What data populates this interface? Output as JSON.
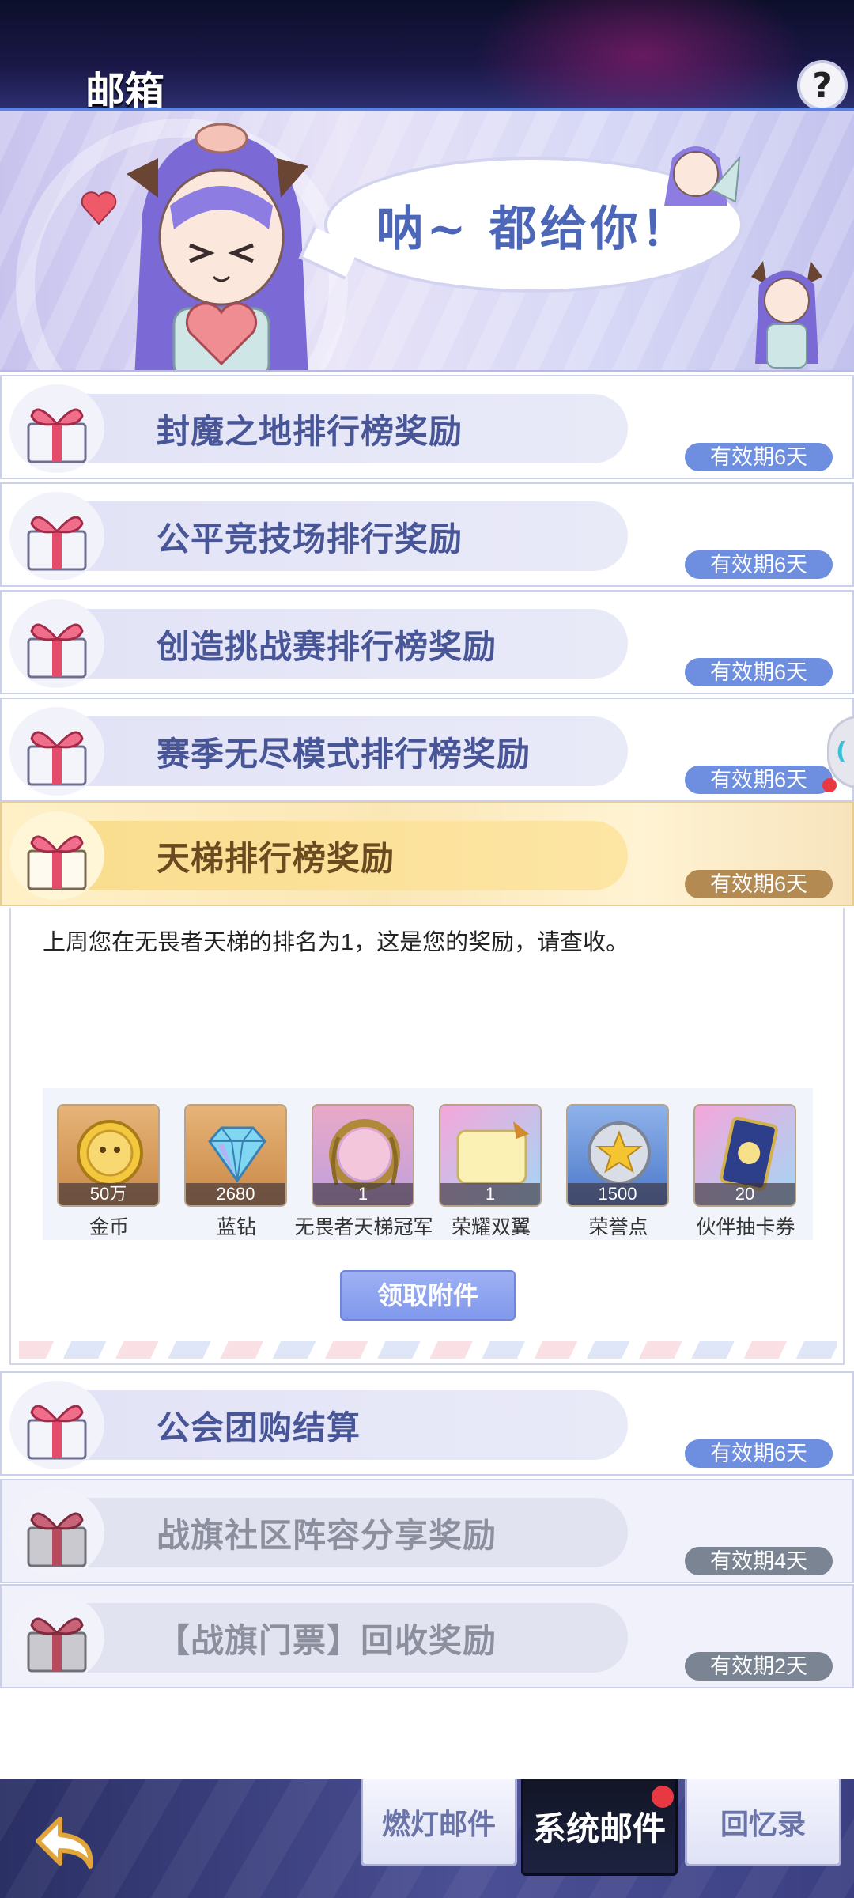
{
  "header": {
    "title": "邮箱",
    "help_glyph": "?"
  },
  "banner": {
    "speech": "呐~ 都给你！"
  },
  "mails": [
    {
      "subject": "封魔之地排行榜奖励",
      "expiry": "有效期6天",
      "state": "unread"
    },
    {
      "subject": "公平竞技场排行奖励",
      "expiry": "有效期6天",
      "state": "unread"
    },
    {
      "subject": "创造挑战赛排行榜奖励",
      "expiry": "有效期6天",
      "state": "unread"
    },
    {
      "subject": "赛季无尽模式排行榜奖励",
      "expiry": "有效期6天",
      "state": "unread",
      "red_dot": true
    },
    {
      "subject": "天梯排行榜奖励",
      "expiry": "有效期6天",
      "state": "selected"
    },
    {
      "subject": "公会团购结算",
      "expiry": "有效期6天",
      "state": "unread"
    },
    {
      "subject": "战旗社区阵容分享奖励",
      "expiry": "有效期4天",
      "state": "read"
    },
    {
      "subject": "【战旗门票】回收奖励",
      "expiry": "有效期2天",
      "state": "read"
    }
  ],
  "detail": {
    "body": "上周您在无畏者天梯的排名为1，这是您的奖励，请查收。",
    "attachments": [
      {
        "name": "金币",
        "qty": "50万",
        "icon": "gold-coin-icon"
      },
      {
        "name": "蓝钻",
        "qty": "2680",
        "icon": "blue-diamond-icon"
      },
      {
        "name": "无畏者天梯冠军",
        "qty": "1",
        "icon": "laurel-frame-icon"
      },
      {
        "name": "荣耀双翼",
        "qty": "1",
        "icon": "wings-card-icon"
      },
      {
        "name": "荣誉点",
        "qty": "1500",
        "icon": "honor-star-icon"
      },
      {
        "name": "伙伴抽卡券",
        "qty": "20",
        "icon": "gacha-ticket-icon"
      }
    ],
    "claim_label": "领取附件"
  },
  "side_tab": {
    "glyph": "("
  },
  "tabs": [
    {
      "label": "燃灯邮件",
      "selected": false
    },
    {
      "label": "系统邮件",
      "selected": true
    },
    {
      "label": "回忆录",
      "selected": false
    }
  ],
  "colors": {
    "accent_blue": "#6e8ee0",
    "selected_gold": "#b28a52",
    "read_gray": "#7a8492",
    "header_bg": "#1a1747",
    "alert_red": "#e83942"
  }
}
